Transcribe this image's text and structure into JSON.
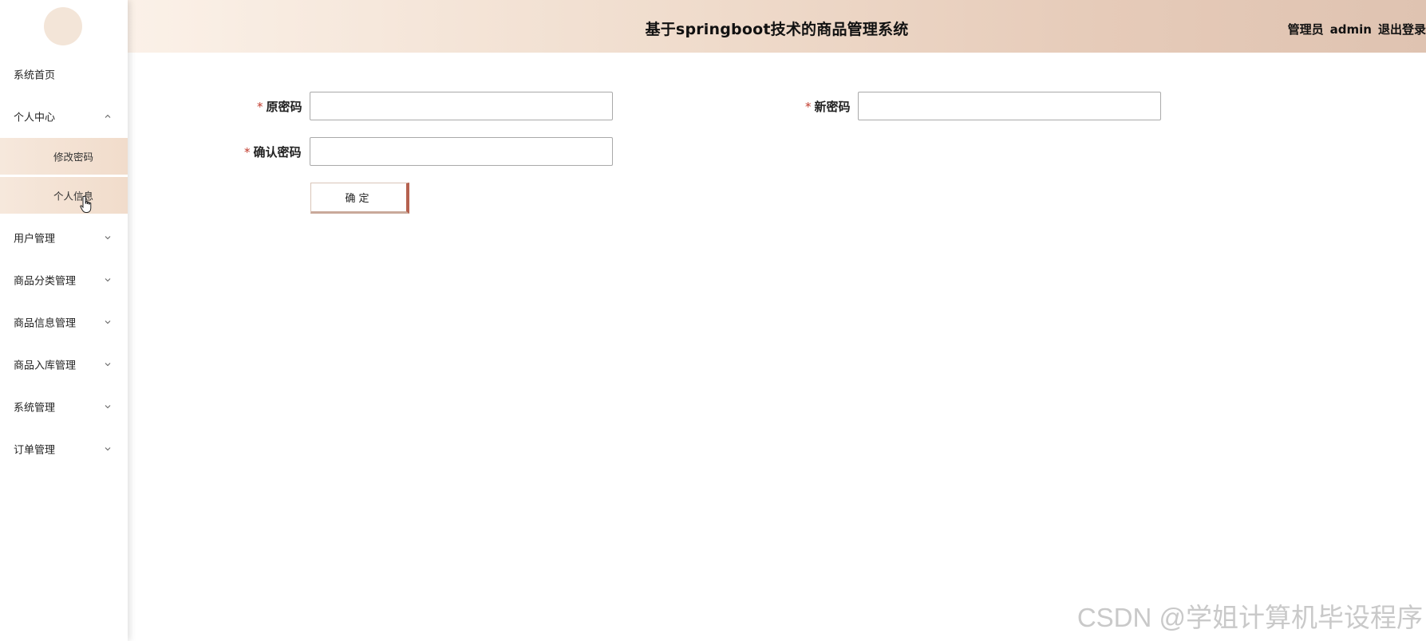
{
  "header": {
    "title": "基于springboot技术的商品管理系统",
    "role": "管理员",
    "username": "admin",
    "logout": "退出登录"
  },
  "sidebar": {
    "items": [
      {
        "label": "系统首页",
        "icon": "none"
      },
      {
        "label": "个人中心",
        "icon": "chevron-up-icon",
        "expanded": true,
        "children": [
          {
            "label": "修改密码"
          },
          {
            "label": "个人信息"
          }
        ]
      },
      {
        "label": "用户管理",
        "icon": "chevron-down-icon"
      },
      {
        "label": "商品分类管理",
        "icon": "chevron-down-icon"
      },
      {
        "label": "商品信息管理",
        "icon": "chevron-down-icon"
      },
      {
        "label": "商品入库管理",
        "icon": "chevron-down-icon"
      },
      {
        "label": "系统管理",
        "icon": "chevron-down-icon"
      },
      {
        "label": "订单管理",
        "icon": "chevron-down-icon"
      }
    ]
  },
  "form": {
    "required_mark": "*",
    "old_password": {
      "label": "原密码",
      "value": ""
    },
    "new_password": {
      "label": "新密码",
      "value": ""
    },
    "confirm_password": {
      "label": "确认密码",
      "value": ""
    },
    "submit_label": "确定"
  },
  "watermark": "CSDN @学姐计算机毕设程序",
  "colors": {
    "header_start": "#fbf1e8",
    "header_end": "#dfc3b1",
    "submenu_bg": "#f3e2d3",
    "required": "#c0392b",
    "button_accent": "#b5614f"
  }
}
